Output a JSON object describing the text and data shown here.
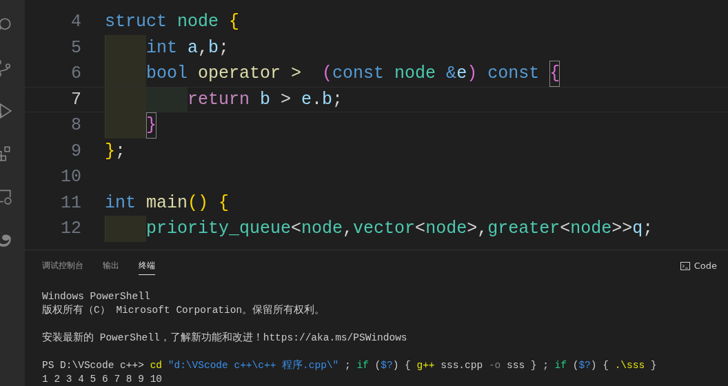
{
  "editor": {
    "lines": [
      {
        "number": "4",
        "current": false,
        "tokens": [
          {
            "text": "struct ",
            "kind": "keyword"
          },
          {
            "text": "node ",
            "kind": "type"
          },
          {
            "text": "{",
            "kind": "bracket1"
          }
        ]
      },
      {
        "number": "5",
        "current": false,
        "tokens": [
          {
            "text": "    int ",
            "kind": "keyword"
          },
          {
            "text": "a",
            "kind": "var"
          },
          {
            "text": ",",
            "kind": "plain"
          },
          {
            "text": "b",
            "kind": "var"
          },
          {
            "text": ";",
            "kind": "plain"
          }
        ]
      },
      {
        "number": "6",
        "current": false,
        "tokens": [
          {
            "text": "    bool ",
            "kind": "keyword"
          },
          {
            "text": "operator ",
            "kind": "func"
          },
          {
            "text": ">  ",
            "kind": "func"
          },
          {
            "text": "(",
            "kind": "bracket2"
          },
          {
            "text": "const ",
            "kind": "keyword"
          },
          {
            "text": "node ",
            "kind": "type"
          },
          {
            "text": "&",
            "kind": "keyword"
          },
          {
            "text": "e",
            "kind": "var"
          },
          {
            "text": ")",
            "kind": "bracket2"
          },
          {
            "text": " const ",
            "kind": "keyword"
          },
          {
            "text": "{",
            "kind": "bracket2",
            "matched": true
          }
        ]
      },
      {
        "number": "7",
        "current": true,
        "tokens": [
          {
            "text": "        return ",
            "kind": "control"
          },
          {
            "text": "b",
            "kind": "var"
          },
          {
            "text": " > ",
            "kind": "plain"
          },
          {
            "text": "e",
            "kind": "var"
          },
          {
            "text": ".",
            "kind": "plain"
          },
          {
            "text": "b",
            "kind": "var"
          },
          {
            "text": ";",
            "kind": "plain"
          }
        ]
      },
      {
        "number": "8",
        "current": false,
        "tokens": [
          {
            "text": "    }",
            "kind": "bracket2",
            "matched": true
          }
        ]
      },
      {
        "number": "9",
        "current": false,
        "tokens": [
          {
            "text": "}",
            "kind": "bracket1"
          },
          {
            "text": ";",
            "kind": "plain"
          }
        ]
      },
      {
        "number": "10",
        "current": false
      },
      {
        "number": "11",
        "current": false,
        "tokens": [
          {
            "text": "int ",
            "kind": "keyword"
          },
          {
            "text": "main",
            "kind": "func"
          },
          {
            "text": "() ",
            "kind": "bracket1"
          },
          {
            "text": "{",
            "kind": "bracket1"
          }
        ]
      },
      {
        "number": "12",
        "current": false,
        "tokens": [
          {
            "text": "    priority_queue",
            "kind": "type"
          },
          {
            "text": "<",
            "kind": "plain"
          },
          {
            "text": "node",
            "kind": "type"
          },
          {
            "text": ",",
            "kind": "plain"
          },
          {
            "text": "vector",
            "kind": "type"
          },
          {
            "text": "<",
            "kind": "plain"
          },
          {
            "text": "node",
            "kind": "type"
          },
          {
            "text": ">,",
            "kind": "plain"
          },
          {
            "text": "greater",
            "kind": "type"
          },
          {
            "text": "<",
            "kind": "plain"
          },
          {
            "text": "node",
            "kind": "type"
          },
          {
            "text": ">>",
            "kind": "plain"
          },
          {
            "text": "q",
            "kind": "var"
          },
          {
            "text": ";",
            "kind": "plain"
          }
        ]
      }
    ]
  },
  "panel": {
    "tabs": [
      {
        "label": "调试控制台",
        "selected": false
      },
      {
        "label": "输出",
        "selected": false
      },
      {
        "label": "终端",
        "selected": true
      }
    ],
    "terminal_name": "Code",
    "terminal_blocks": [
      [
        [
          {
            "text": "Windows PowerShell",
            "kind": "plain"
          }
        ],
        [
          {
            "text": "版权所有（C） Microsoft Corporation。保留所有权利。",
            "kind": "plain"
          }
        ]
      ],
      [
        [
          {
            "text": "安装最新的 PowerShell，了解新功能和改进！https://aka.ms/PSWindows",
            "kind": "plain"
          }
        ]
      ],
      [
        [
          {
            "text": "PS D:\\VScode c++> ",
            "kind": "plain"
          },
          {
            "text": "cd ",
            "kind": "command"
          },
          {
            "text": "\"d:\\VScode c++\\c++ 程序.cpp\\\"",
            "kind": "string"
          },
          {
            "text": " ; ",
            "kind": "plain"
          },
          {
            "text": "if",
            "kind": "keyword"
          },
          {
            "text": " (",
            "kind": "plain"
          },
          {
            "text": "$?",
            "kind": "variable"
          },
          {
            "text": ") { ",
            "kind": "plain"
          },
          {
            "text": "g++",
            "kind": "command"
          },
          {
            "text": " sss.cpp ",
            "kind": "plain"
          },
          {
            "text": "-o",
            "kind": "param"
          },
          {
            "text": " sss } ; ",
            "kind": "plain"
          },
          {
            "text": "if",
            "kind": "keyword"
          },
          {
            "text": " (",
            "kind": "plain"
          },
          {
            "text": "$?",
            "kind": "variable"
          },
          {
            "text": ") { ",
            "kind": "plain"
          },
          {
            "text": ".\\sss",
            "kind": "command"
          },
          {
            "text": " }",
            "kind": "plain"
          }
        ],
        [
          {
            "text": "1 2 3 4 5 6 7 8 9 10",
            "kind": "plain"
          }
        ]
      ]
    ]
  }
}
